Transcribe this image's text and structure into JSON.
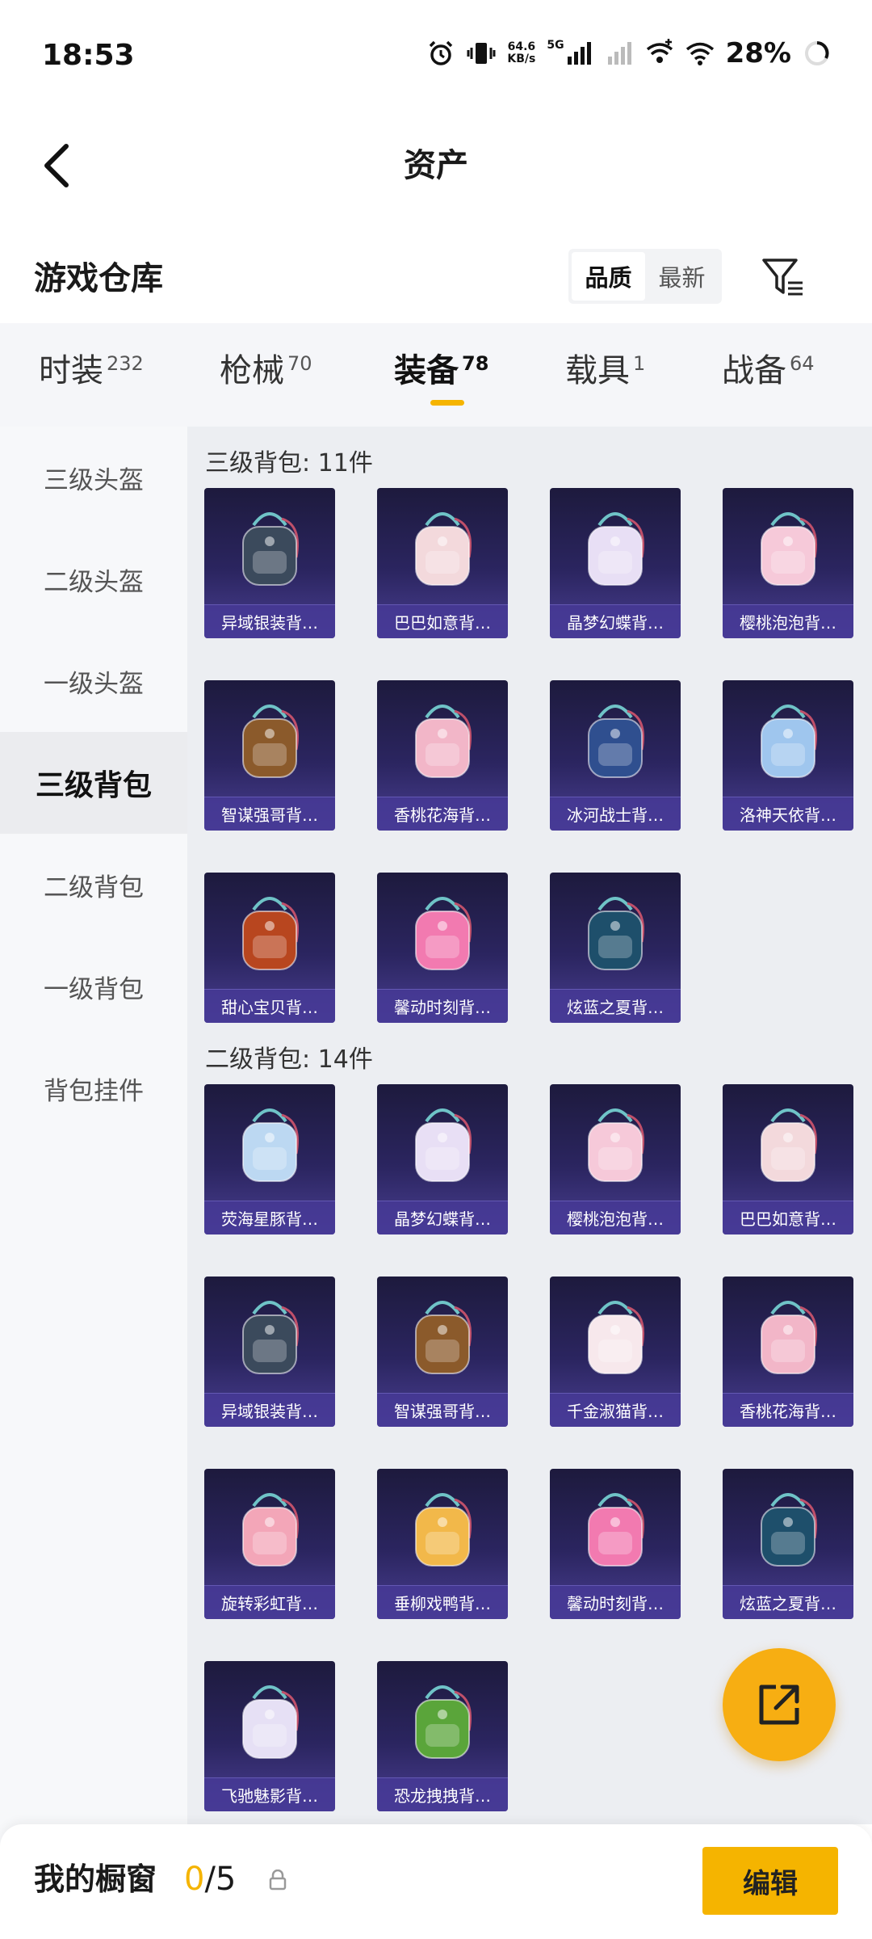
{
  "status_bar": {
    "time": "18:53",
    "net_speed_value": "64.6",
    "net_speed_unit": "KB/s",
    "network": "5G",
    "battery": "28%"
  },
  "header": {
    "title": "资产"
  },
  "warehouse": {
    "title": "游戏仓库",
    "sort_options": [
      "品质",
      "最新"
    ],
    "active_sort": "品质"
  },
  "categories": [
    {
      "label": "时装",
      "count": "232"
    },
    {
      "label": "枪械",
      "count": "70"
    },
    {
      "label": "装备",
      "count": "78"
    },
    {
      "label": "载具",
      "count": "1"
    },
    {
      "label": "战备",
      "count": "64"
    }
  ],
  "active_category": "装备",
  "sidebar": {
    "items": [
      "三级头盔",
      "二级头盔",
      "一级头盔",
      "三级背包",
      "二级背包",
      "一级背包",
      "背包挂件"
    ],
    "active": "三级背包"
  },
  "sections": [
    {
      "title": "三级背包: 11件",
      "items": [
        {
          "name": "异域银装背…",
          "color": "#3b4a5c"
        },
        {
          "name": "巴巴如意背…",
          "color": "#f3d9dc"
        },
        {
          "name": "晶梦幻蝶背…",
          "color": "#e8dff5"
        },
        {
          "name": "樱桃泡泡背…",
          "color": "#f6c9d9"
        },
        {
          "name": "智谋强哥背…",
          "color": "#8b5a2b"
        },
        {
          "name": "香桃花海背…",
          "color": "#f2b6c8"
        },
        {
          "name": "冰河战士背…",
          "color": "#2f4f8f"
        },
        {
          "name": "洛神天依背…",
          "color": "#9fc6ee"
        },
        {
          "name": "甜心宝贝背…",
          "color": "#b8461f"
        },
        {
          "name": "馨动时刻背…",
          "color": "#f27ab0"
        },
        {
          "name": "炫蓝之夏背…",
          "color": "#1e4f6b"
        }
      ]
    },
    {
      "title": "二级背包: 14件",
      "items": [
        {
          "name": "荧海星豚背…",
          "color": "#bcd8f2"
        },
        {
          "name": "晶梦幻蝶背…",
          "color": "#e8dff5"
        },
        {
          "name": "樱桃泡泡背…",
          "color": "#f6c9d9"
        },
        {
          "name": "巴巴如意背…",
          "color": "#f3d9dc"
        },
        {
          "name": "异域银装背…",
          "color": "#3b4a5c"
        },
        {
          "name": "智谋强哥背…",
          "color": "#8b5a2b"
        },
        {
          "name": "千金淑猫背…",
          "color": "#f7e8ec"
        },
        {
          "name": "香桃花海背…",
          "color": "#f2b6c8"
        },
        {
          "name": "旋转彩虹背…",
          "color": "#f3a6b8"
        },
        {
          "name": "垂柳戏鸭背…",
          "color": "#f2b84a"
        },
        {
          "name": "馨动时刻背…",
          "color": "#f27ab0"
        },
        {
          "name": "炫蓝之夏背…",
          "color": "#1e4f6b"
        },
        {
          "name": "飞驰魅影背…",
          "color": "#e6e0f5"
        },
        {
          "name": "恐龙拽拽背…",
          "color": "#5aa53a"
        }
      ]
    }
  ],
  "bottom_bar": {
    "title": "我的橱窗",
    "current": "0",
    "total": "/5",
    "edit_label": "编辑"
  },
  "colors": {
    "accent": "#f5b400",
    "fab": "#f7ae12"
  },
  "icons": {
    "back": "chevron-left-icon",
    "filter": "filter-icon",
    "share": "share-external-icon",
    "lock": "lock-icon"
  }
}
